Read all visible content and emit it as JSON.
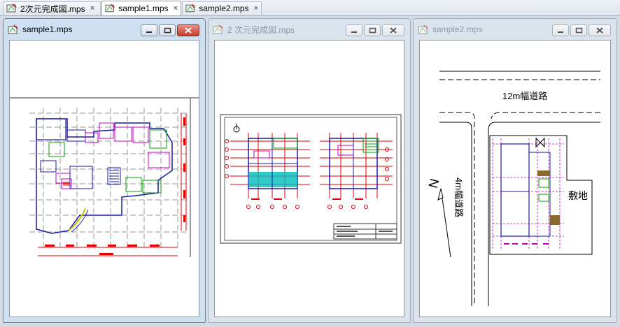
{
  "tabs": [
    {
      "label": "2次元完成図.mps",
      "close": "×",
      "active": false
    },
    {
      "label": "sample1.mps",
      "close": "×",
      "active": true
    },
    {
      "label": "sample2.mps",
      "close": "×",
      "active": false
    }
  ],
  "windows": [
    {
      "title": "sample1.mps",
      "active": true
    },
    {
      "title": "2 次元完成図.mps",
      "active": false
    },
    {
      "title": "sample2.mps",
      "active": false
    }
  ],
  "sample2_labels": {
    "road_12m": "12m幅道路",
    "road_4m": "4m幅道路",
    "site": "敷地",
    "north": "N"
  },
  "colors": {
    "active_close": "#c43c2c",
    "plan_blue": "#1a1aa8",
    "plan_magenta": "#c000c0",
    "plan_green": "#00a000",
    "plan_red": "#e00000",
    "plan_cyan": "#00c0c0",
    "grid_gray": "#9a9a9a"
  }
}
